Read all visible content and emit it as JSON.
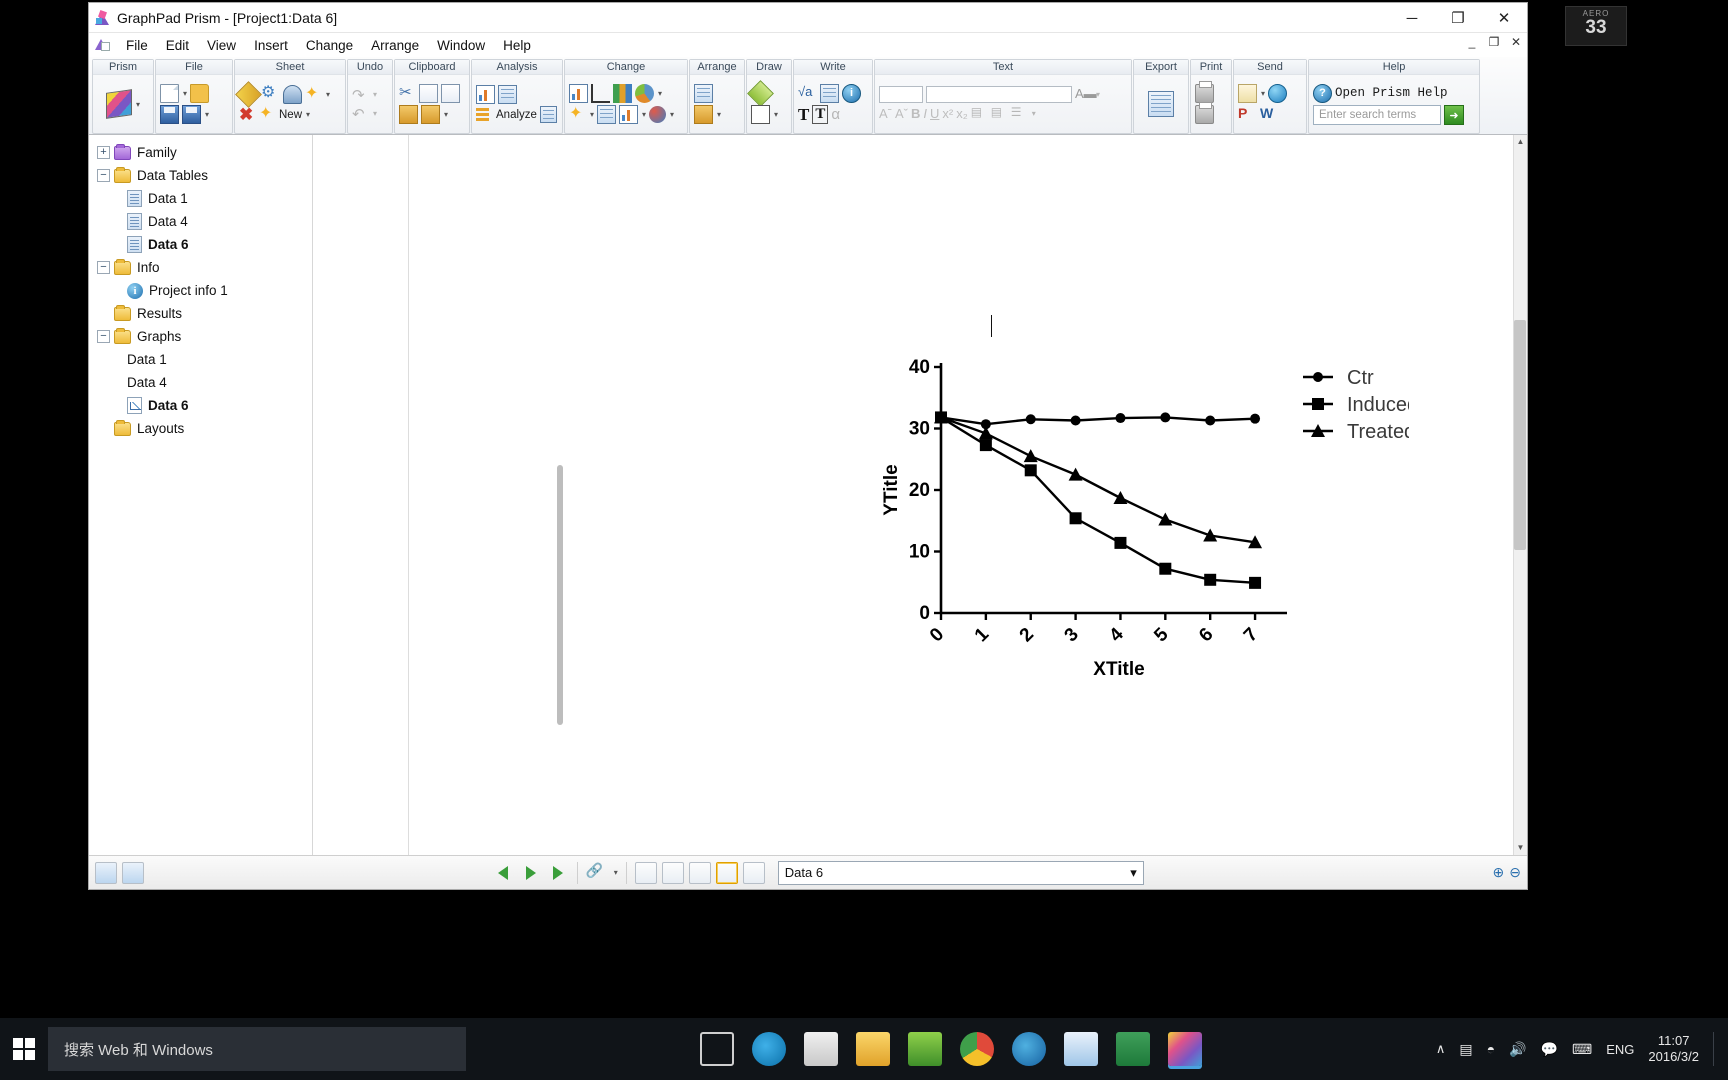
{
  "aero": {
    "label": "AERO",
    "value": "33"
  },
  "window": {
    "title": "GraphPad Prism - [Project1:Data 6]",
    "app_icon": "prism-logo-icon",
    "controls": {
      "minimize": "─",
      "maximize": "❐",
      "close": "✕"
    },
    "mdi_controls": {
      "minimize": "_",
      "restore": "❐",
      "close": "✕"
    }
  },
  "menu": {
    "items": [
      "File",
      "Edit",
      "View",
      "Insert",
      "Change",
      "Arrange",
      "Window",
      "Help"
    ]
  },
  "ribbon": {
    "groups": [
      {
        "name": "Prism",
        "title": "Prism"
      },
      {
        "name": "File",
        "title": "File"
      },
      {
        "name": "Sheet",
        "title": "Sheet",
        "new_label": "New"
      },
      {
        "name": "Undo",
        "title": "Undo"
      },
      {
        "name": "Clipboard",
        "title": "Clipboard"
      },
      {
        "name": "Analysis",
        "title": "Analysis",
        "analyze_label": "Analyze"
      },
      {
        "name": "Change",
        "title": "Change"
      },
      {
        "name": "Arrange",
        "title": "Arrange"
      },
      {
        "name": "Draw",
        "title": "Draw"
      },
      {
        "name": "Write",
        "title": "Write"
      },
      {
        "name": "Text",
        "title": "Text"
      },
      {
        "name": "Export",
        "title": "Export"
      },
      {
        "name": "Print",
        "title": "Print"
      },
      {
        "name": "Send",
        "title": "Send"
      },
      {
        "name": "Help",
        "title": "Help"
      }
    ],
    "text_group": {
      "font_value": "",
      "size_value": "",
      "buttons": [
        "Aˉ",
        "Aˇ",
        "B",
        "I",
        "U",
        "x²",
        "x₂"
      ]
    },
    "help_group": {
      "open_help_label": "Open Prism Help",
      "search_placeholder": "Enter search terms",
      "go_label": "➜"
    }
  },
  "sidebar": {
    "items": [
      {
        "label": "Family",
        "level": 0,
        "icon": "folder-purple-icon",
        "expander": "+",
        "bold": false
      },
      {
        "label": "Data Tables",
        "level": 0,
        "icon": "folder-yellow-icon",
        "expander": "-",
        "bold": false
      },
      {
        "label": "Data 1",
        "level": 1,
        "icon": "data-table-icon",
        "expander": "",
        "bold": false
      },
      {
        "label": "Data 4",
        "level": 1,
        "icon": "data-table-icon",
        "expander": "",
        "bold": false
      },
      {
        "label": "Data 6",
        "level": 1,
        "icon": "data-table-icon",
        "expander": "",
        "bold": true
      },
      {
        "label": "Info",
        "level": 0,
        "icon": "folder-yellow-icon",
        "expander": "-",
        "bold": false
      },
      {
        "label": "Project info 1",
        "level": 1,
        "icon": "info-icon",
        "expander": "",
        "bold": false
      },
      {
        "label": "Results",
        "level": 0,
        "icon": "folder-yellow-icon",
        "expander": "",
        "bold": false
      },
      {
        "label": "Graphs",
        "level": 0,
        "icon": "folder-yellow-icon",
        "expander": "-",
        "bold": false
      },
      {
        "label": "Data 1",
        "level": 1,
        "icon": "graph-bar-icon",
        "expander": "",
        "bold": false
      },
      {
        "label": "Data 4",
        "level": 1,
        "icon": "graph-bar-icon",
        "expander": "",
        "bold": false
      },
      {
        "label": "Data 6",
        "level": 1,
        "icon": "graph-line-icon",
        "expander": "",
        "bold": true
      },
      {
        "label": "Layouts",
        "level": 0,
        "icon": "folder-yellow-icon",
        "expander": "",
        "bold": false
      }
    ]
  },
  "statusbar": {
    "sheet_selector_value": "Data 6",
    "dropdown_caret": "▾",
    "nav_prev": "prev-sheet-arrow",
    "nav_next": "next-sheet-arrow",
    "zoom_in": "⊕",
    "zoom_out": "⊖"
  },
  "taskbar": {
    "search_placeholder": "搜索 Web 和 Windows",
    "language": "ENG",
    "time": "11:07",
    "date": "2016/3/2",
    "chevron": "∧"
  },
  "chart_data": {
    "type": "line",
    "title": "",
    "xlabel": "XTitle",
    "ylabel": "YTitle",
    "xlim": [
      0,
      7.4
    ],
    "ylim": [
      0,
      40
    ],
    "yticks": [
      0,
      10,
      20,
      30,
      40
    ],
    "xticks": [
      0,
      1,
      2,
      3,
      4,
      5,
      6,
      7
    ],
    "xtick_rotation": -45,
    "grid": false,
    "legend_position": "right",
    "x": [
      0,
      1,
      2,
      3,
      4,
      5,
      6,
      7
    ],
    "series": [
      {
        "name": "Ctr",
        "marker": "circle",
        "values": [
          31.8,
          30.7,
          31.5,
          31.3,
          31.7,
          31.8,
          31.3,
          31.6
        ]
      },
      {
        "name": "Induced",
        "marker": "square",
        "values": [
          31.8,
          27.3,
          23.2,
          15.4,
          11.4,
          7.2,
          5.4,
          4.9
        ]
      },
      {
        "name": "Treated",
        "marker": "triangle",
        "values": [
          31.8,
          29.2,
          25.5,
          22.5,
          18.7,
          15.2,
          12.6,
          11.5
        ]
      }
    ]
  }
}
